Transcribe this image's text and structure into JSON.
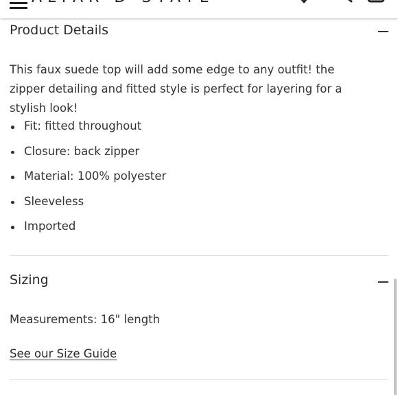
{
  "header": {
    "logo_text": "ALTAR'D STATE"
  },
  "product_details": {
    "title": "Product Details",
    "description": "This faux suede top will add some edge to any outfit! the zipper detailing and fitted style is perfect for layering for a stylish look!",
    "bullets": [
      "Fit: fitted throughout",
      "Closure: back zipper",
      "Material: 100% polyester",
      "Sleeveless",
      "Imported"
    ]
  },
  "sizing": {
    "title": "Sizing",
    "measurements": "Measurements: 16\" length",
    "size_guide_link": "See our Size Guide"
  }
}
